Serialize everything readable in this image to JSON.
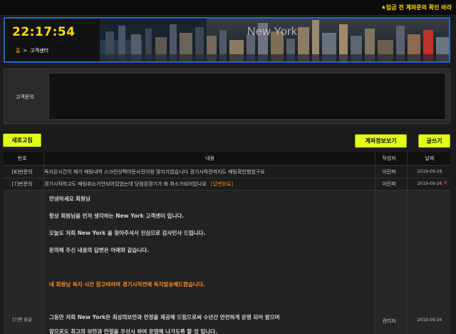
{
  "top_notice": "★입금 전 계좌문의 확인 바라",
  "header": {
    "clock": "22:17:54",
    "breadcrumb_home": "홈",
    "breadcrumb_sep": ">",
    "breadcrumb_current": "고객센터",
    "banner_title": "New York"
  },
  "inquiry": {
    "label": "고객문의",
    "value": "",
    "placeholder": ""
  },
  "buttons": {
    "refresh": "새로고침",
    "account_info": "계좌정보보기",
    "write": "글쓰기"
  },
  "table": {
    "headers": {
      "num": "번호",
      "content": "내용",
      "writer": "작성자",
      "date": "날짜"
    },
    "rows": [
      {
        "num": "[8]번문의",
        "content": "독지온시간이 제가 배팅내역 스크린샷찍어둔사진이랑 맞지가않습니다 경기시작전까지도 배팅확인했었구요",
        "badge": "",
        "writer": "아진파",
        "date": "2019-09-26"
      },
      {
        "num": "[7]번문의",
        "content": "경기시작하고도 배팅취소가안되어있었는데 당첨된경기가 왜 취소가되어있나요",
        "badge": "[답변완료]",
        "writer": "아진파",
        "date": "2019-09-26"
      }
    ],
    "detail": {
      "num": "[7]번 답글",
      "lines": [
        "안녕하세요 회원님",
        "항상 회원님을 먼저 생각하는 New York 고객센터 입니다.",
        "오늘도 저희 New York 을 찾아주셔서 진심으로 감사인사 드립니다.",
        "문의해 주신 내용의 답변은 아래와 같습니다.",
        "네 회원님 독지 시간 참고바라며 경기시작전에 독지발송해드렸습니다.",
        "그동안 저희 New York은 최상의보안과 안정을 제공해 드림으로써 수년간 안전하게 운영 되어 왔으며",
        "앞으로도 최고의 보안과 안정을 우선시 하여 운영해 나가도록 할 것 입니다."
      ],
      "writer": "관리자",
      "date": "2019-09-26"
    }
  },
  "colors": {
    "accent_yellow": "#e2ff1a",
    "clock_yellow": "#ffd800",
    "header_border": "#2b63c4",
    "orange": "#ff8a1e",
    "delete_red": "#e02222"
  }
}
